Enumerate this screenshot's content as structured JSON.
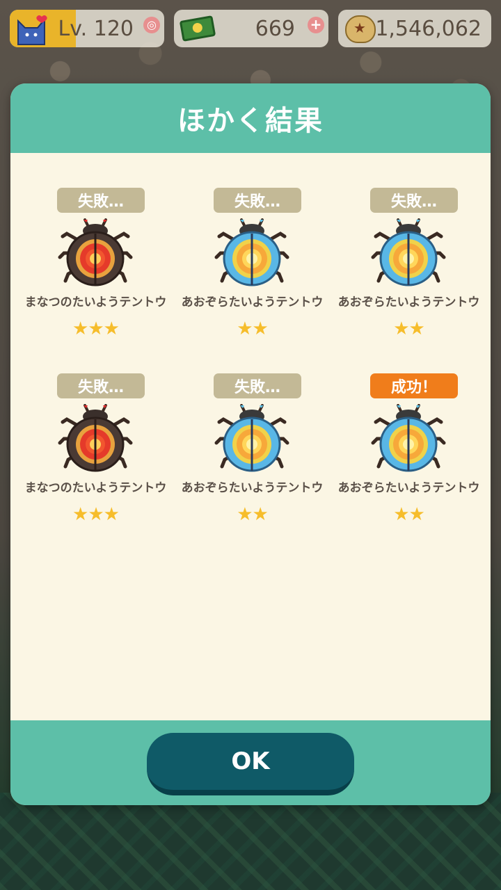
{
  "hud": {
    "level": "Lv. 120",
    "leaf_tickets": "669",
    "bells": "1,546,062"
  },
  "modal": {
    "title": "ほかく結果",
    "ok_label": "OK"
  },
  "results": [
    {
      "status": "失敗…",
      "success": false,
      "name": "まなつのたいようテントウ",
      "stars": "★★★",
      "bug_color": "red"
    },
    {
      "status": "失敗…",
      "success": false,
      "name": "あおぞらたいようテントウ",
      "stars": "★★",
      "bug_color": "blue"
    },
    {
      "status": "失敗…",
      "success": false,
      "name": "あおぞらたいようテントウ",
      "stars": "★★",
      "bug_color": "blue"
    },
    {
      "status": "失敗…",
      "success": false,
      "name": "まなつのたいようテントウ",
      "stars": "★★★",
      "bug_color": "red"
    },
    {
      "status": "失敗…",
      "success": false,
      "name": "あおぞらたいようテントウ",
      "stars": "★★",
      "bug_color": "blue"
    },
    {
      "status": "成功！",
      "success": true,
      "name": "あおぞらたいようテントウ",
      "stars": "★★",
      "bug_color": "blue"
    }
  ],
  "colors": {
    "header": "#5dbfa8",
    "ok_button": "#0f5a67",
    "fail_badge": "#c3b996",
    "success_badge": "#f07d1b",
    "star": "#f6bd2b"
  }
}
